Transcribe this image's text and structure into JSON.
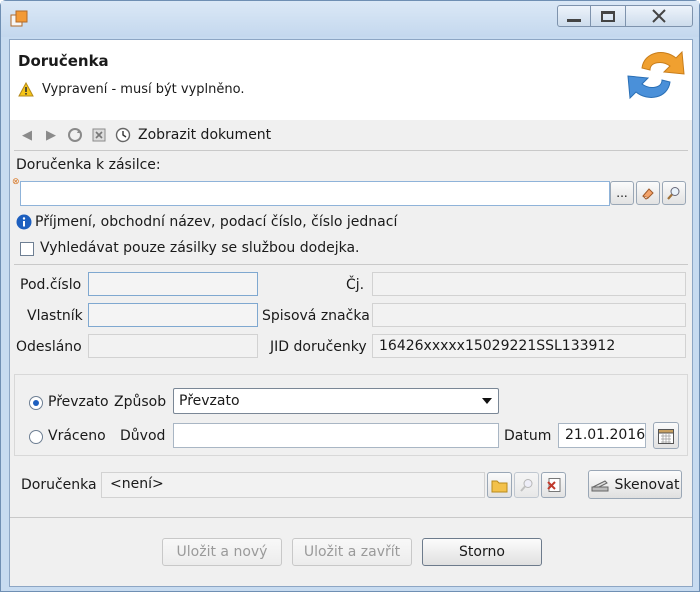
{
  "header": {
    "title": "Doručenka",
    "message": "Vypravení - musí být vyplněno."
  },
  "toolbar": {
    "show_document": "Zobrazit dokument"
  },
  "form": {
    "dorucenka_k_zasilce_label": "Doručenka k zásilce:",
    "search_value": "",
    "hint": "Příjmení, obchodní název, podací číslo, číslo jednací",
    "only_dodejka_label": "Vyhledávat pouze zásilky se službou dodejka.",
    "only_dodejka_checked": false,
    "browse_label": "...",
    "pod_cislo_label": "Pod.číslo",
    "pod_cislo_value": "",
    "cj_label": "Čj.",
    "cj_value": "",
    "vlastnik_label": "Vlastník",
    "vlastnik_value": "",
    "spisova_znacka_label": "Spisová značka",
    "spisova_znacka_value": "",
    "odeslano_label": "Odesláno",
    "odeslano_value": "",
    "jid_label": "JID doručenky",
    "jid_value": "16426xxxxx15029221SSL133912"
  },
  "delivery": {
    "prevzato_label": "Převzato",
    "prevzato_selected": true,
    "zpusob_label": "Způsob",
    "zpusob_value": "Převzato",
    "vraceno_label": "Vráceno",
    "duvod_label": "Důvod",
    "duvod_value": "",
    "datum_label": "Datum",
    "datum_value": "21.01.2016"
  },
  "attachment": {
    "label": "Doručenka",
    "value": "<není>",
    "scan_label": "Skenovat"
  },
  "buttons": {
    "save_new": "Uložit a nový",
    "save_close": "Uložit a zavřít",
    "cancel": "Storno"
  },
  "colors": {
    "title_bar": "#c4d8ee",
    "accent": "#1d5fbf",
    "logo_orange": "#f0a030",
    "logo_blue": "#4a90d9"
  }
}
